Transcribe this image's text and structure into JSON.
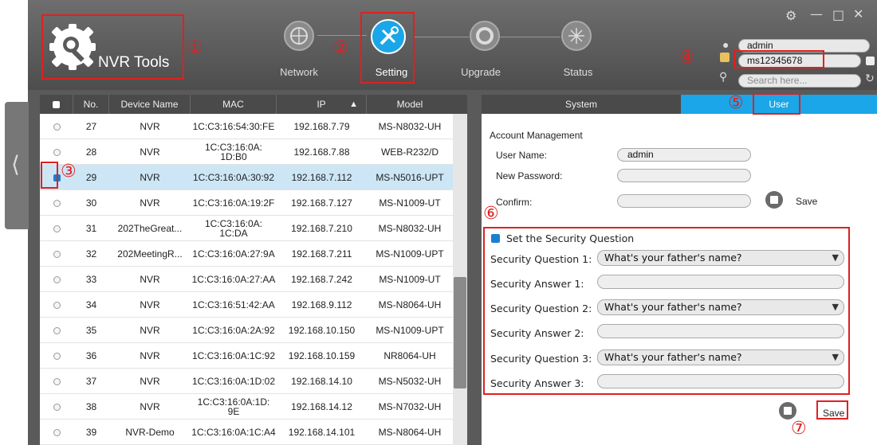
{
  "app": {
    "title": "NVR Tools"
  },
  "steps": [
    {
      "label": "Network"
    },
    {
      "label": "Setting"
    },
    {
      "label": "Upgrade"
    },
    {
      "label": "Status"
    }
  ],
  "login": {
    "username": "admin",
    "password": "ms12345678",
    "search_placeholder": "Search here..."
  },
  "annotations": [
    "①",
    "②",
    "③",
    "④",
    "⑤",
    "⑥",
    "⑦"
  ],
  "table": {
    "columns": [
      "No.",
      "Device Name",
      "MAC",
      "IP",
      "Model"
    ],
    "sort_indicator": "▲",
    "rows": [
      {
        "no": "27",
        "name": "NVR",
        "mac": "1C:C3:16:54:30:FE",
        "ip": "192.168.7.79",
        "model": "MS-N8032-UH",
        "selected": false
      },
      {
        "no": "28",
        "name": "NVR",
        "mac": "1C:C3:16:0A:\n1D:B0",
        "ip": "192.168.7.88",
        "model": "WEB-R232/D",
        "selected": false
      },
      {
        "no": "29",
        "name": "NVR",
        "mac": "1C:C3:16:0A:30:92",
        "ip": "192.168.7.112",
        "model": "MS-N5016-UPT",
        "selected": true
      },
      {
        "no": "30",
        "name": "NVR",
        "mac": "1C:C3:16:0A:19:2F",
        "ip": "192.168.7.127",
        "model": "MS-N1009-UT",
        "selected": false
      },
      {
        "no": "31",
        "name": "202TheGreat...",
        "mac": "1C:C3:16:0A:\n1C:DA",
        "ip": "192.168.7.210",
        "model": "MS-N8032-UH",
        "selected": false
      },
      {
        "no": "32",
        "name": "202MeetingR...",
        "mac": "1C:C3:16:0A:27:9A",
        "ip": "192.168.7.211",
        "model": "MS-N1009-UPT",
        "selected": false
      },
      {
        "no": "33",
        "name": "NVR",
        "mac": "1C:C3:16:0A:27:AA",
        "ip": "192.168.7.242",
        "model": "MS-N1009-UT",
        "selected": false
      },
      {
        "no": "34",
        "name": "NVR",
        "mac": "1C:C3:16:51:42:AA",
        "ip": "192.168.9.112",
        "model": "MS-N8064-UH",
        "selected": false
      },
      {
        "no": "35",
        "name": "NVR",
        "mac": "1C:C3:16:0A:2A:92",
        "ip": "192.168.10.150",
        "model": "MS-N1009-UPT",
        "selected": false
      },
      {
        "no": "36",
        "name": "NVR",
        "mac": "1C:C3:16:0A:1C:92",
        "ip": "192.168.10.159",
        "model": "NR8064-UH",
        "selected": false
      },
      {
        "no": "37",
        "name": "NVR",
        "mac": "1C:C3:16:0A:1D:02",
        "ip": "192.168.14.10",
        "model": "MS-N5032-UH",
        "selected": false
      },
      {
        "no": "38",
        "name": "NVR",
        "mac": "1C:C3:16:0A:1D:\n9E",
        "ip": "192.168.14.12",
        "model": "MS-N7032-UH",
        "selected": false
      },
      {
        "no": "39",
        "name": "NVR-Demo",
        "mac": "1C:C3:16:0A:1C:A4",
        "ip": "192.168.14.101",
        "model": "MS-N8064-UH",
        "selected": false
      }
    ]
  },
  "tabs": {
    "system": "System",
    "user": "User"
  },
  "account": {
    "heading": "Account Management",
    "user_name_label": "User Name:",
    "user_name_value": "admin",
    "new_password_label": "New Password:",
    "confirm_label": "Confirm:",
    "save_label": "Save"
  },
  "security": {
    "heading": "Set the Security Question",
    "q1_label": "Security Question 1:",
    "q1_value": "What's your father's name?",
    "a1_label": "Security Answer 1:",
    "q2_label": "Security Question 2:",
    "q2_value": "What's your father's name?",
    "a2_label": "Security Answer 2:",
    "q3_label": "Security Question 3:",
    "q3_value": "What's your father's name?",
    "a3_label": "Security Answer 3:",
    "save_label": "Save"
  },
  "colors": {
    "accent": "#1aa6e8",
    "annotation": "#e02020"
  }
}
